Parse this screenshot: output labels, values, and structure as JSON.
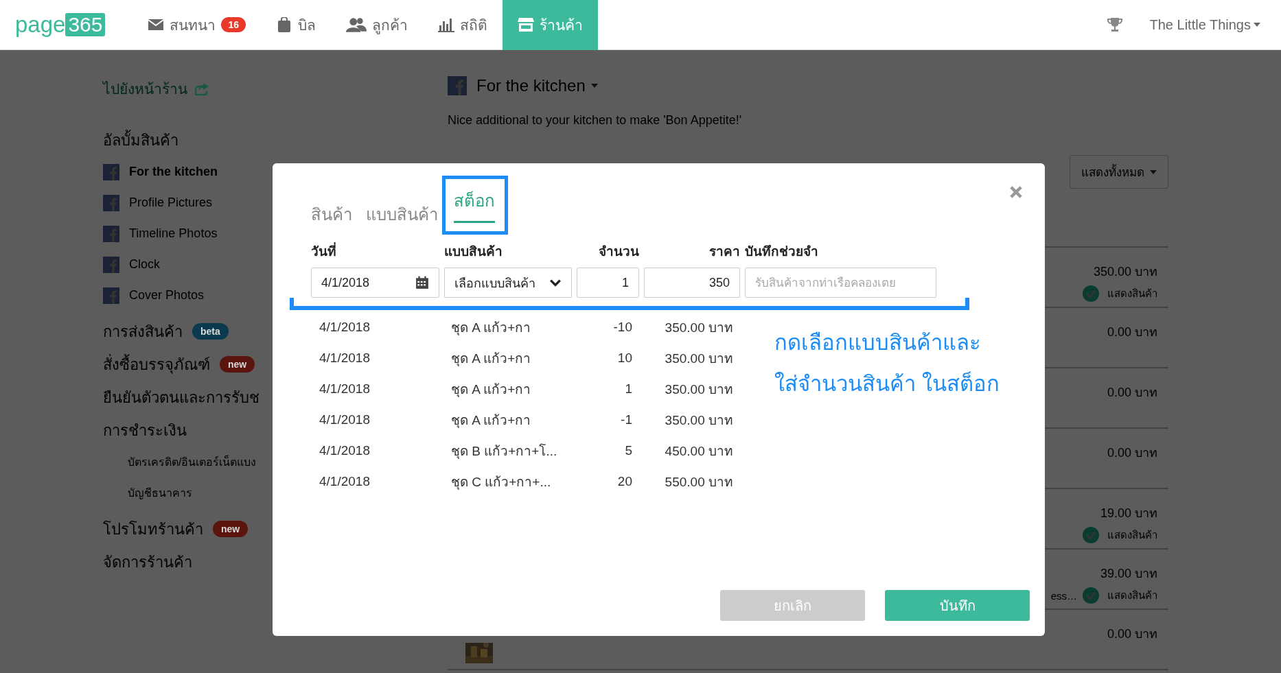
{
  "topbar": {
    "logo": {
      "text": "page",
      "accent": "365"
    },
    "nav": [
      {
        "label": "สนทนา",
        "badge": "16",
        "selected": false
      },
      {
        "label": "บิล",
        "selected": false
      },
      {
        "label": "ลูกค้า",
        "selected": false
      },
      {
        "label": "สถิติ",
        "selected": false
      },
      {
        "label": "ร้านค้า",
        "selected": true
      }
    ],
    "user": "The Little Things"
  },
  "sidebar": {
    "store_link": "ไปยังหน้าร้าน",
    "sections": [
      {
        "kind": "albums",
        "title": "อัลบั้มสินค้า",
        "items": [
          {
            "label": "For the kitchen",
            "selected": true
          },
          {
            "label": "Profile Pictures",
            "selected": false
          },
          {
            "label": "Timeline Photos",
            "selected": false
          },
          {
            "label": "Clock",
            "selected": false
          },
          {
            "label": "Cover Photos",
            "selected": false
          }
        ]
      },
      {
        "title": "การส่งสินค้า",
        "badge": "beta",
        "color": "#0b3a4f"
      },
      {
        "title": "สั่งซื้อบรรจุภัณฑ์",
        "badge": "new",
        "color": "#5a150e"
      },
      {
        "title": "ยืนยันตัวตนและการรับช"
      },
      {
        "kind": "plain",
        "title": "การชำระเงิน",
        "items": [
          {
            "label": "บัตรเครดิต/อินเตอร์เน็ตแบง"
          },
          {
            "label": "บัญชีธนาคาร"
          }
        ]
      },
      {
        "title": "โปรโมทร้านค้า",
        "badge": "new",
        "color": "#5a150e"
      },
      {
        "title": "จัดการร้านค้า"
      }
    ]
  },
  "main": {
    "album_title": "For the kitchen",
    "description": "Nice additional to your kitchen to make 'Bon Appetite!'",
    "filter": "แสดงทั้งหมด",
    "products": [
      {
        "price": "350.00 บาท",
        "status": "แสดงสินค้า"
      },
      {
        "price": "0.00 บาท"
      },
      {
        "price": "0.00 บาท"
      },
      {
        "price": "0.00 บาท"
      },
      {
        "price": "19.00 บาท",
        "status": "แสดงสินค้า"
      },
      {
        "price": "39.00 บาท",
        "note": "ess…",
        "status": "แสดงสินค้า"
      },
      {
        "price": "0.00 บาท",
        "kind": "picture"
      }
    ]
  },
  "modal": {
    "tabs": [
      {
        "label": "สินค้า",
        "selected": false
      },
      {
        "label": "แบบสินค้า",
        "selected": false
      },
      {
        "label": "สต็อก",
        "selected": true
      }
    ],
    "columns": [
      "วันที่",
      "แบบสินค้า",
      "จำนวน",
      "ราคา",
      "บันทึกช่วยจำ"
    ],
    "form": {
      "date": "4/1/2018",
      "variant": "เลือกแบบสินค้า",
      "quantity": "1",
      "price": "350",
      "note_placeholder": "รับสินค้าจากท่าเรือคลองเตย"
    },
    "rows": [
      {
        "date": "4/1/2018",
        "variant": "ชุด A แก้ว+กา",
        "quantity": "-10",
        "price": "350.00 บาท"
      },
      {
        "date": "4/1/2018",
        "variant": "ชุด A แก้ว+กา",
        "quantity": "10",
        "price": "350.00 บาท"
      },
      {
        "date": "4/1/2018",
        "variant": "ชุด A แก้ว+กา",
        "quantity": "1",
        "price": "350.00 บาท"
      },
      {
        "date": "4/1/2018",
        "variant": "ชุด A แก้ว+กา",
        "quantity": "-1",
        "price": "350.00 บาท"
      },
      {
        "date": "4/1/2018",
        "variant": "ชุด B แก้ว+กา+โ...",
        "quantity": "5",
        "price": "450.00 บาท"
      },
      {
        "date": "4/1/2018",
        "variant": "ชุด C แก้ว+กา+...",
        "quantity": "20",
        "price": "550.00 บาท"
      }
    ],
    "callout": [
      "กดเลือกแบบสินค้าและ",
      "ใส่จำนวนสินค้า ในสต็อก"
    ],
    "buttons": [
      {
        "label": "ยกเลิก",
        "kind": "cancel"
      },
      {
        "label": "บันทึก",
        "kind": "save"
      }
    ]
  }
}
